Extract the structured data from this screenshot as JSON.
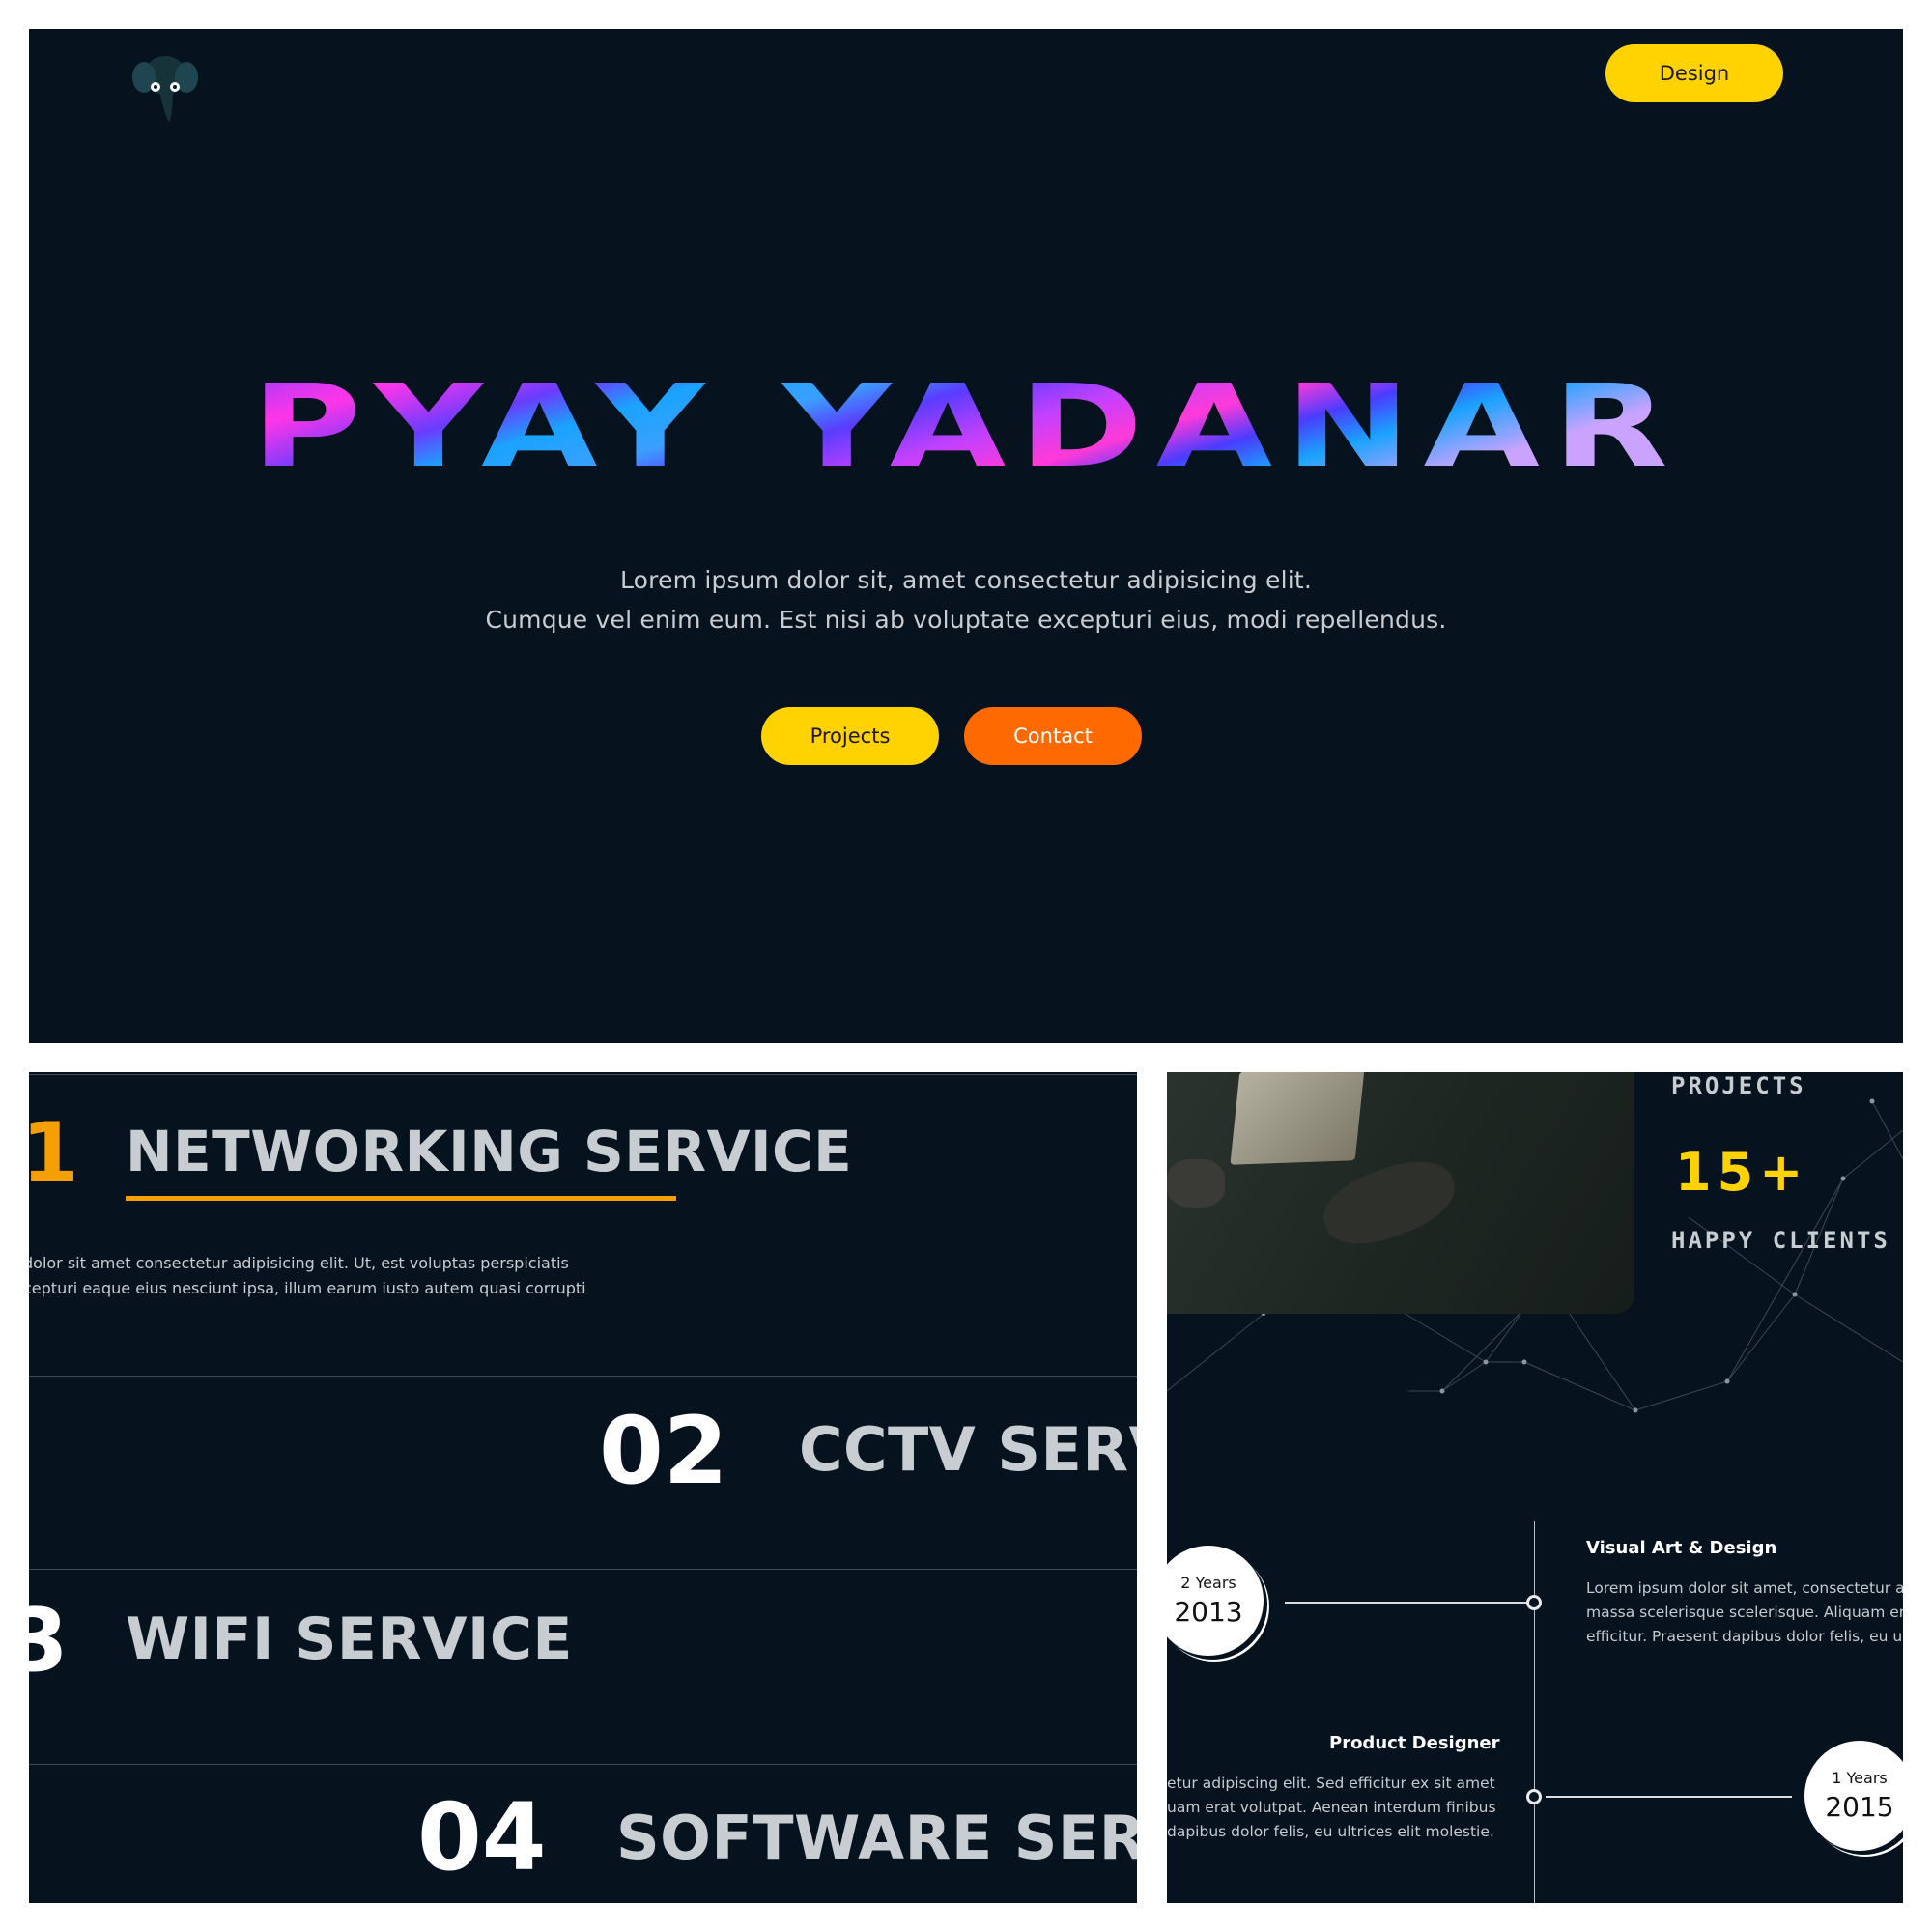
{
  "hero": {
    "title": "PYAY YADANAR",
    "subtitle_line1": "Lorem ipsum dolor sit, amet consectetur adipisicing elit.",
    "subtitle_line2": "Cumque vel enim eum. Est nisi ab voluptate excepturi eius, modi repellendus.",
    "design_label": "Design",
    "projects_label": "Projects",
    "contact_label": "Contact",
    "logo_icon": "elephant-logo-icon"
  },
  "services": {
    "items": [
      {
        "number": "1",
        "title": "NETWORKING SERVICE",
        "desc_line1": "dolor sit amet consectetur adipisicing elit. Ut, est voluptas perspiciatis",
        "desc_line2": "cepturi eaque eius nesciunt ipsa, illum earum iusto autem quasi corrupti"
      },
      {
        "number": "02",
        "title": "CCTV SERV"
      },
      {
        "number": "3",
        "title": "WIFI SERVICE"
      },
      {
        "number": "04",
        "title": "SOFTWARE SERV"
      }
    ]
  },
  "stats": {
    "top_label": "PROJECTS",
    "number": "15+",
    "bottom_label": "HAPPY CLIENTS"
  },
  "timeline": {
    "entries": [
      {
        "years": "2 Years",
        "year": "2013",
        "title": "Visual Art & Design",
        "lines": [
          "Lorem ipsum dolor sit amet, consectetur ad",
          "massa scelerisque scelerisque. Aliquam era",
          "efficitur. Praesent dapibus dolor felis, eu ult"
        ]
      },
      {
        "years": "1 Years",
        "year": "2015",
        "title": "Product Designer",
        "lines": [
          "etur adipiscing elit. Sed efficitur ex sit amet",
          "uam erat volutpat. Aenean interdum finibus",
          "dapibus dolor felis, eu ultrices elit molestie."
        ]
      }
    ]
  },
  "colors": {
    "background": "#06121e",
    "yellow": "#ffd200",
    "orange": "#ff6a00",
    "underline": "#f5a000"
  }
}
